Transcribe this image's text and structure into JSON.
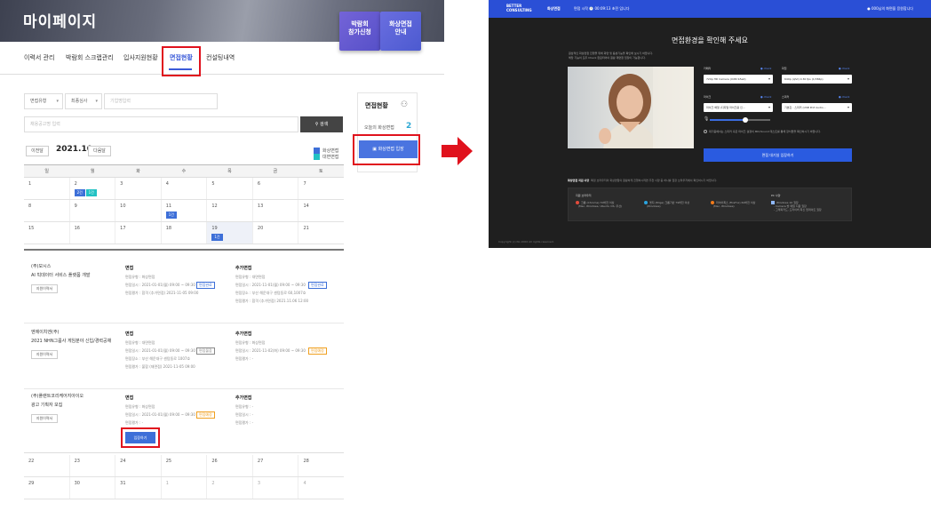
{
  "left": {
    "banner_title": "마이페이지",
    "banner_buttons": [
      {
        "label": "박람회\n참가신청"
      },
      {
        "label": "화상면접\n안내"
      }
    ],
    "tabs": [
      "이력서 관리",
      "박람회 스크랩관리",
      "입사지원현황",
      "면접현황",
      "컨설팅내역"
    ],
    "active_tab": "면접현황",
    "filter": {
      "type": "면접유형",
      "status": "최종심사",
      "company_placeholder": "기업명입력",
      "keyword_placeholder": "채용공고명 입력",
      "search_label": "검색"
    },
    "panel": {
      "title": "면접현황",
      "today_label": "오늘의 화상면접",
      "today_count": "2",
      "enter_label": "화상면접 입장"
    },
    "calendar": {
      "prev": "이전달",
      "month": "2021.10",
      "next": "다음달",
      "legend": [
        "화상면접",
        "대면면접"
      ],
      "weekdays": [
        "일",
        "월",
        "화",
        "수",
        "목",
        "금",
        "토"
      ],
      "weeks": [
        [
          {
            "d": "1"
          },
          {
            "d": "2",
            "tags": [
              {
                "t": "2건",
                "c": "blue"
              },
              {
                "t": "1건",
                "c": "teal"
              }
            ]
          },
          {
            "d": "3"
          },
          {
            "d": "4"
          },
          {
            "d": "5"
          },
          {
            "d": "6"
          },
          {
            "d": "7"
          }
        ],
        [
          {
            "d": "8"
          },
          {
            "d": "9"
          },
          {
            "d": "10"
          },
          {
            "d": "11",
            "tags": [
              {
                "t": "1건",
                "c": "blue"
              }
            ]
          },
          {
            "d": "12"
          },
          {
            "d": "13"
          },
          {
            "d": "14"
          }
        ],
        [
          {
            "d": "15"
          },
          {
            "d": "16"
          },
          {
            "d": "17"
          },
          {
            "d": "18"
          },
          {
            "d": "19",
            "hl": true,
            "tags": [
              {
                "t": "1건",
                "c": "blue"
              }
            ]
          },
          {
            "d": "20"
          },
          {
            "d": "21"
          }
        ]
      ],
      "extra_weeks": [
        [
          {
            "d": "22"
          },
          {
            "d": "23"
          },
          {
            "d": "24"
          },
          {
            "d": "25"
          },
          {
            "d": "26"
          },
          {
            "d": "27"
          },
          {
            "d": "28"
          }
        ],
        [
          {
            "d": "29"
          },
          {
            "d": "30"
          },
          {
            "d": "31"
          },
          {
            "d": "1",
            "m": true
          },
          {
            "d": "2",
            "m": true
          },
          {
            "d": "3",
            "m": true
          },
          {
            "d": "4",
            "m": true
          }
        ]
      ]
    },
    "entries": [
      {
        "company": "(주)모시스",
        "title": "AI 빅데이터 서비스 플랫폼 개발",
        "resume": "지원이력서",
        "interview_head": "면접",
        "interview": [
          "면접유형 : 화상면접",
          "면접일시 : 2021-01-01(월) 09:00 ~ 09:30",
          "면접평가 : 합격 (추가면접) 2021-11-05 09:00"
        ],
        "interview_pill": "면접완료",
        "extra_head": "추가면접",
        "extra": [
          "면접유형 : 대면면접",
          "면접일시 : 2021-11-01(월) 09:00 ~ 09:30",
          "면접장소 : 부산 해운대구 센텀동로 60,1007호",
          "면접평가 : 합격 (추가면접) 2021.11.06 12:00"
        ],
        "extra_pill": "면접완료"
      },
      {
        "company": "엔에이치엔(주)",
        "title": "2021 NHN그룹사 게임분야 신입/경력공채",
        "resume": "지원이력서",
        "interview_head": "면접",
        "interview": [
          "면접유형 : 대면면접",
          "면접일시 : 2021-01-01(월) 09:00 ~ 09:30",
          "면접장소 : 부산 해운대구 센텀동로 1007호",
          "면접평가 : 불합 (재면접) 2021-11-05 09:00"
        ],
        "interview_pill": "면접불참",
        "extra_head": "추가면접",
        "extra": [
          "면접유형 : 화상면접",
          "면접일시 : 2021-11-02(화) 09:00 ~ 09:30",
          "면접평가 : -"
        ],
        "extra_pill": "면접예정"
      },
      {
        "company": "(주)플랜트코리케어지아이오",
        "title": "광고 기획자 모집",
        "resume": "지원이력서",
        "interview_head": "면접",
        "interview": [
          "면접유형 : 화상면접",
          "면접일시 : 2021-01-01(월) 09:00 ~ 09:30",
          "면접평가 : -"
        ],
        "interview_pill": "면접예정",
        "extra_head": "추가면접",
        "extra": [
          "면접유형 : -",
          "면접일시 : -",
          "면접평가 : -"
        ],
        "enter_label": "입장하기"
      }
    ]
  },
  "right": {
    "logo": "BETTER\nCONSULTING",
    "title": "화상면접",
    "timer": "면접 시작 🕐 00:09:13 초전 입니다",
    "user_msg": "● 000님의 화면을 응원합니다",
    "heading": "면접환경을 확인해 주세요",
    "subtext": "원남적인 화상면접 진행을 위해 화면 및 음성기능을 확인해 보시기 바랍니다.\n해당 기능이 모두 Check 완료되어야 원활 재면접 입장이 가능합니다.",
    "camera_label": "카메라",
    "camera_value": "720p HD Camera (04f2:b5e0)",
    "res_label": "화질",
    "res_value": "640p (qhd) 0.30 fps (1/384p)",
    "mic_label": "마이크",
    "mic_value": "마이크 배열 (디지털 마이크용 인...",
    "spk_label": "스피커",
    "spk_value": "기본값 - 스피커 (USB PnP Audio...",
    "check": "● check",
    "note": "대기중에서는 스피커 혹은 마이크 설정이 MIC/Sound 테스트를 통해 장치들을 확인하시기 바랍니다.",
    "start_label": "면접 대기실 입장하기",
    "env_title": "화상면접 지원 사양",
    "env_desc": "특정 브라우저의 화상면접의 원활하게 진행하시려면 추천 사양 중 하나를 권장 브라우저에서 확인하시기 바랍니다.",
    "env_browser_head": "지원 브라우저",
    "env_pc_head": "PC 사양",
    "browsers": [
      {
        "name": "크롬 (Chrome) 70버전 이상",
        "os": "(Mac, Windows, Ubuntu OS, 우선)",
        "color": "#e24b3b"
      },
      {
        "name": "엣지 (Edge) 크롬기반 79버전 이상",
        "os": "(Windows)",
        "color": "#2aa4e0"
      },
      {
        "name": "파이어폭스 (FireFox) 60버전 이상",
        "os": "(Mac, Windows)",
        "color": "#f07a1a"
      }
    ],
    "pc": [
      "Windows 10 권장",
      "- Camera 방 메일 지원 권장",
      "- 그래픽카드, 드라이버 최신 업데이트 권장"
    ],
    "copyright": "Copyright (c) No 2000 All rights reserved."
  }
}
